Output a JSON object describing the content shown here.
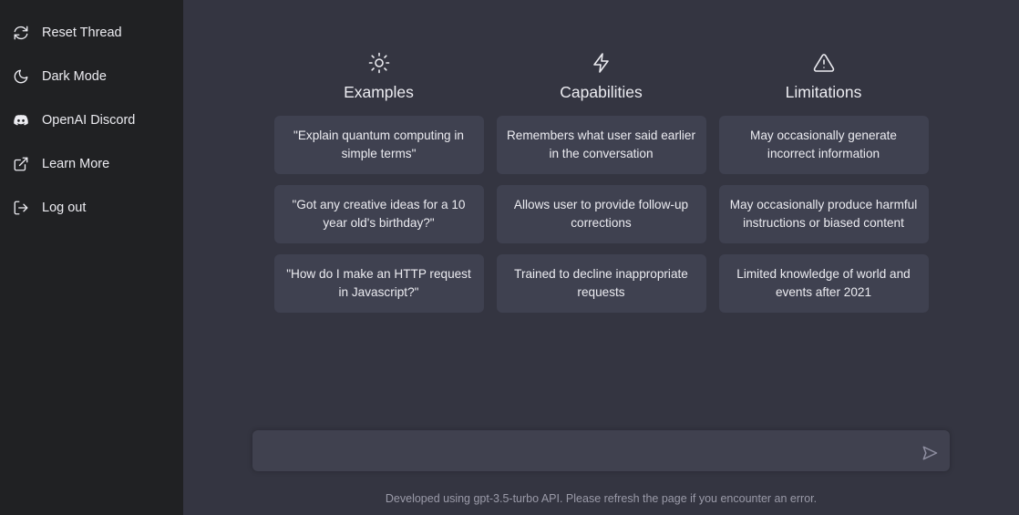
{
  "sidebar": {
    "items": [
      {
        "label": "Reset Thread",
        "icon": "reset-icon"
      },
      {
        "label": "Dark Mode",
        "icon": "moon-icon"
      },
      {
        "label": "OpenAI Discord",
        "icon": "discord-icon"
      },
      {
        "label": "Learn More",
        "icon": "external-link-icon"
      },
      {
        "label": "Log out",
        "icon": "logout-icon"
      }
    ]
  },
  "columns": [
    {
      "title": "Examples",
      "icon": "sun-icon",
      "cards": [
        "\"Explain quantum computing in simple terms\"",
        "\"Got any creative ideas for a 10 year old's birthday?\"",
        "\"How do I make an HTTP request in Javascript?\""
      ]
    },
    {
      "title": "Capabilities",
      "icon": "lightning-icon",
      "cards": [
        "Remembers what user said earlier in the conversation",
        "Allows user to provide follow-up corrections",
        "Trained to decline inappropriate requests"
      ]
    },
    {
      "title": "Limitations",
      "icon": "warning-icon",
      "cards": [
        "May occasionally generate incorrect information",
        "May occasionally produce harmful instructions or biased content",
        "Limited knowledge of world and events after 2021"
      ]
    }
  ],
  "composer": {
    "value": "",
    "placeholder": "",
    "send_icon": "send-icon"
  },
  "footer": {
    "note": "Developed using gpt-3.5-turbo API. Please refresh the page if you encounter an error."
  },
  "colors": {
    "sidebar_bg": "#202123",
    "main_bg": "#343541",
    "card_bg": "#3f4150",
    "input_bg": "#40414f",
    "text": "#ececf1",
    "muted_text": "#9a9aa8"
  }
}
